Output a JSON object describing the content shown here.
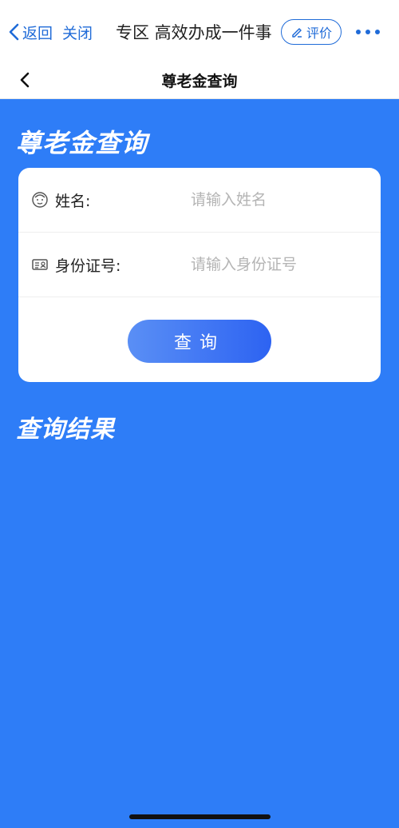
{
  "nav": {
    "back_label": "返回",
    "close_label": "关闭",
    "title": "专区  高效办成一件事",
    "rate_label": "评价"
  },
  "page": {
    "header_title": "尊老金查询",
    "big_title": "尊老金查询",
    "results_title": "查询结果"
  },
  "form": {
    "name_label": "姓名:",
    "name_placeholder": "请输入姓名",
    "id_label": "身份证号:",
    "id_placeholder": "请输入身份证号",
    "submit_label": "查询"
  },
  "colors": {
    "background": "#2e7df7",
    "link": "#1f6bd8",
    "button_start": "#5a8ff5",
    "button_end": "#2d63f2"
  },
  "icons": {
    "back": "chevron-left-icon",
    "rate": "pencil-icon",
    "more": "more-dots-icon",
    "name": "face-icon",
    "id": "id-card-icon"
  }
}
